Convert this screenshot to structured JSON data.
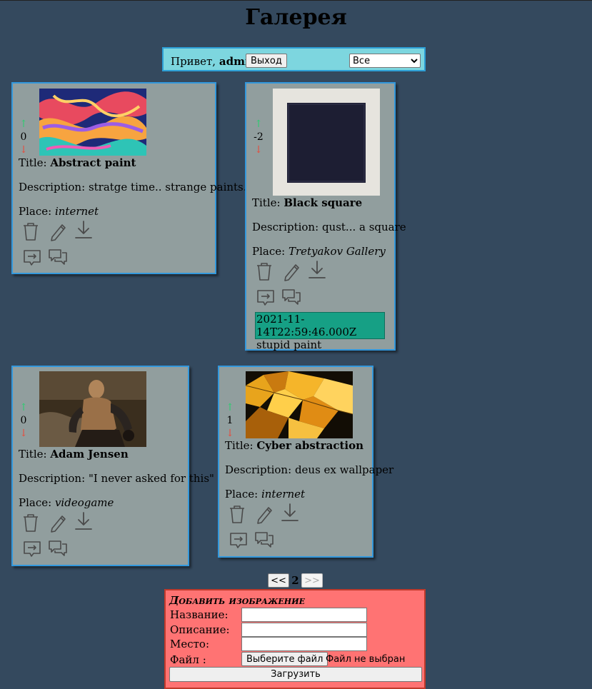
{
  "page_title": "Галерея",
  "userbar": {
    "greeting": "Привет,",
    "username": "admin",
    "logout_label": "Выход",
    "filter_selected": "Все"
  },
  "card_labels": {
    "title": "Title:",
    "description": "Description:",
    "place": "Place:"
  },
  "cards": [
    {
      "score": "0",
      "title": "Abstract paint",
      "description": "stratge time.. strange paints..",
      "place": "internet"
    },
    {
      "score": "-2",
      "title": "Black square",
      "description": "qust... a square",
      "place": "Tretyakov Gallery",
      "comment": {
        "timestamp": "2021-11-14T22:59:46.000Z",
        "text": "stupid paint"
      }
    },
    {
      "score": "0",
      "title": "Adam Jensen",
      "description": "\"I never asked for this\"",
      "place": "videogame"
    },
    {
      "score": "1",
      "title": "Cyber abstraction",
      "description": "deus ex wallpaper",
      "place": "internet"
    }
  ],
  "icons": {
    "up": "↑",
    "down": "↓",
    "delete": "trash-icon",
    "edit": "pencil-icon",
    "download": "download-icon",
    "share": "share-icon",
    "comments": "comments-icon"
  },
  "pagination": {
    "prev_label": "<<",
    "current_page": "2",
    "next_label": ">>"
  },
  "add_form": {
    "title": "Добавить изображение",
    "name_label": "Название:",
    "description_label": "Описание:",
    "place_label": "Место:",
    "file_label": "Файл :",
    "choose_file_label": "Выберите файл",
    "file_status": "Файл не выбран",
    "upload_label": "Загрузить"
  },
  "colors": {
    "background": "#34495e",
    "card": "#919e9e",
    "card_border": "#3398dc",
    "userbar": "#7dd6df",
    "form": "#ff7373",
    "comment": "#16a085",
    "vote_up": "#2ecc71",
    "vote_down": "#e74c3c"
  }
}
